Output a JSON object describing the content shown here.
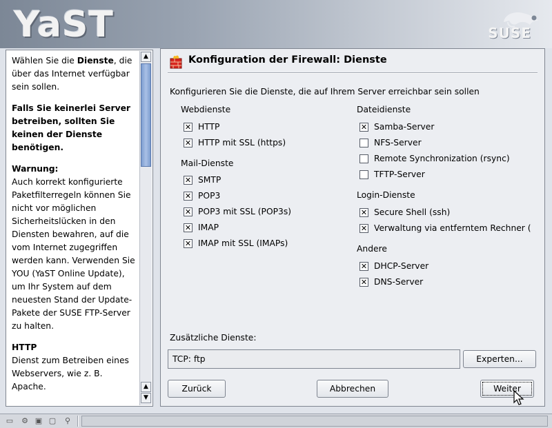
{
  "banner": {
    "logo_text": "YaST",
    "vendor_text": "SUSE"
  },
  "help": {
    "paragraphs": [
      {
        "pre": "Wählen Sie die ",
        "bold": "Dienste",
        "post": ", die über das Internet verfügbar sein sollen."
      },
      {
        "bold_text": "Falls Sie keinerlei Server betreiben, sollten Sie keinen der Dienste benötigen."
      },
      {
        "heading": "Warnung:",
        "text": "Auch korrekt konfigurierte Paketfilterregeln können Sie nicht vor möglichen Sicherheitslücken in den Diensten bewahren, auf die vom Internet zugegriffen werden kann. Verwenden Sie YOU (YaST Online Update), um Ihr System auf dem neuesten Stand der Update-Pakete der SUSE FTP-Server zu halten."
      },
      {
        "heading": "HTTP",
        "text": "Dienst zum Betreiben eines Webservers, wie z. B. Apache."
      }
    ],
    "scroll_up_icon": "arrow-up-icon",
    "scroll_down_icon": "arrow-down-icon"
  },
  "dialog": {
    "title": "Konfiguration der Firewall: Dienste",
    "title_icon": "firewall-icon",
    "intro": "Konfigurieren Sie die Dienste, die auf Ihrem Server erreichbar sein sollen",
    "groups": {
      "web": {
        "label": "Webdienste",
        "items": [
          {
            "label": "HTTP",
            "checked": true
          },
          {
            "label": "HTTP mit SSL (https)",
            "checked": true
          }
        ]
      },
      "mail": {
        "label": "Mail-Dienste",
        "items": [
          {
            "label": "SMTP",
            "checked": true
          },
          {
            "label": "POP3",
            "checked": true
          },
          {
            "label": "POP3 mit SSL (POP3s)",
            "checked": true
          },
          {
            "label": "IMAP",
            "checked": true
          },
          {
            "label": "IMAP mit SSL (IMAPs)",
            "checked": true
          }
        ]
      },
      "file": {
        "label": "Dateidienste",
        "items": [
          {
            "label": "Samba-Server",
            "checked": true
          },
          {
            "label": "NFS-Server",
            "checked": false
          },
          {
            "label": "Remote Synchronization (rsync)",
            "checked": false
          },
          {
            "label": "TFTP-Server",
            "checked": false
          }
        ]
      },
      "login": {
        "label": "Login-Dienste",
        "items": [
          {
            "label": "Secure Shell (ssh)",
            "checked": true
          },
          {
            "label": "Verwaltung via entferntem Rechner (",
            "checked": true
          }
        ]
      },
      "other": {
        "label": "Andere",
        "items": [
          {
            "label": "DHCP-Server",
            "checked": true
          },
          {
            "label": "DNS-Server",
            "checked": true
          }
        ]
      }
    },
    "extra_label": "Zusätzliche Dienste:",
    "extra_value": "TCP: ftp",
    "buttons": {
      "expert": "Experten...",
      "back": "Zurück",
      "cancel": "Abbrechen",
      "next": "Weiter"
    }
  },
  "taskbar": {
    "icons": [
      "window-list-icon",
      "gear-icon",
      "save-icon",
      "folder-icon",
      "network-icon"
    ]
  }
}
